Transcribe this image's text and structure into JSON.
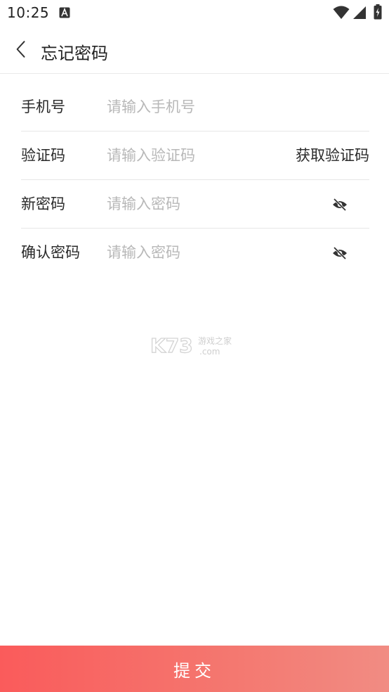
{
  "status_bar": {
    "time": "10:25",
    "notification_icon": "a-notification-icon",
    "wifi_icon": "wifi-icon",
    "signal_icon": "signal-icon",
    "battery_icon": "battery-charging-icon"
  },
  "header": {
    "back_icon": "chevron-left-icon",
    "title": "忘记密码"
  },
  "form": {
    "phone": {
      "label": "手机号",
      "placeholder": "请输入手机号"
    },
    "code": {
      "label": "验证码",
      "placeholder": "请输入验证码",
      "action": "获取验证码"
    },
    "new_password": {
      "label": "新密码",
      "placeholder": "请输入密码",
      "toggle_icon": "eye-hidden-icon"
    },
    "confirm_password": {
      "label": "确认密码",
      "placeholder": "请输入密码",
      "toggle_icon": "eye-hidden-icon"
    }
  },
  "watermark": {
    "brand": "K73",
    "subtitle": "游戏之家",
    "domain": ".com"
  },
  "submit": {
    "label": "提交"
  },
  "colors": {
    "submit_gradient_start": "#fa5b5b",
    "submit_gradient_end": "#f18c83",
    "placeholder": "#b8b8b8",
    "divider": "#e6e6e6"
  }
}
